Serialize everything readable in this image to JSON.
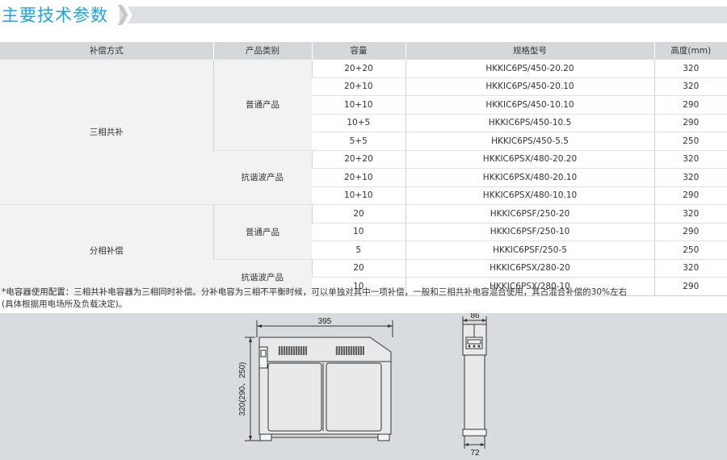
{
  "title": "主要技术参数",
  "table": {
    "headers": [
      "补偿方式",
      "产品类别",
      "容量",
      "规格型号",
      "高度(mm)"
    ],
    "groups": [
      {
        "method": "三相共补",
        "categories": [
          {
            "name": "普通产品",
            "rows": [
              {
                "capacity": "20+20",
                "model": "HKKIC6PS/450-20.20",
                "height": "320"
              },
              {
                "capacity": "20+10",
                "model": "HKKIC6PS/450-20.10",
                "height": "320"
              },
              {
                "capacity": "10+10",
                "model": "HKKIC6PS/450-10.10",
                "height": "290"
              },
              {
                "capacity": "10+5",
                "model": "HKKIC6PS/450-10.5",
                "height": "290"
              },
              {
                "capacity": "5+5",
                "model": "HKKIC6PS/450-5.5",
                "height": "250"
              }
            ]
          },
          {
            "name": "抗谐波产品",
            "rows": [
              {
                "capacity": "20+20",
                "model": "HKKIC6PSX/480-20.20",
                "height": "320"
              },
              {
                "capacity": "20+10",
                "model": "HKKIC6PSX/480-20.10",
                "height": "320"
              },
              {
                "capacity": "10+10",
                "model": "HKKIC6PSX/480-10.10",
                "height": "290"
              }
            ]
          }
        ]
      },
      {
        "method": "分相补偿",
        "categories": [
          {
            "name": "普通产品",
            "rows": [
              {
                "capacity": "20",
                "model": "HKKIC6PSF/250-20",
                "height": "320"
              },
              {
                "capacity": "10",
                "model": "HKKIC6PSF/250-10",
                "height": "290"
              },
              {
                "capacity": "5",
                "model": "HKKIC6PSF/250-5",
                "height": "250"
              }
            ]
          },
          {
            "name": "抗谐波产品",
            "rows": [
              {
                "capacity": "20",
                "model": "HKKIC6PSX/280-20",
                "height": "320"
              },
              {
                "capacity": "10",
                "model": "HKKIC6PSX/280-10",
                "height": "290"
              }
            ]
          }
        ]
      }
    ]
  },
  "note": {
    "line1": "*电容器使用配置：三相共补电容器为三相同时补偿。分补电容为三相不平衡时候，可以单独对其中一项补偿，一般和三相共补电容混合使用，其占混合补偿的30%左右",
    "line2": "(具体根据用电场所及负载决定)。"
  },
  "drawing": {
    "front_width_label": "395",
    "front_height_label": "320(290、250)",
    "side_top_label": "86",
    "side_bottom_label": "72"
  },
  "colors": {
    "title": "#1aa6e0",
    "header_bg": "#d5d8db",
    "merged_bg": "#f1f2f3",
    "drawing_bg": "#d9dcdf"
  }
}
